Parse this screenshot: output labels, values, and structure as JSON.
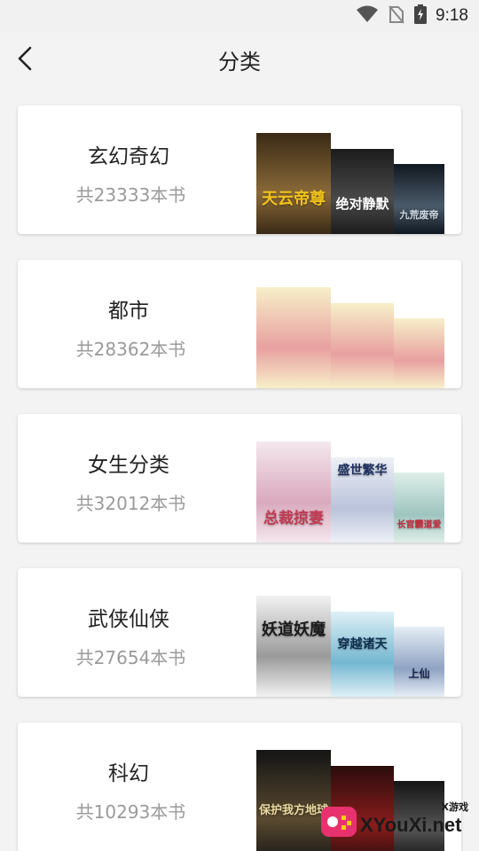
{
  "status_bar": {
    "time": "9:18",
    "icons": [
      "wifi-icon",
      "no-sim-icon",
      "battery-charging-icon"
    ]
  },
  "header": {
    "title": "分类",
    "back_icon": "chevron-left-icon"
  },
  "categories": [
    {
      "name": "玄幻奇幻",
      "count": "共23333本书",
      "covers": [
        {
          "title": "天云帝尊",
          "palette": [
            "#3a2a16",
            "#8a6a38",
            "#f1c31a"
          ]
        },
        {
          "title": "绝对静默",
          "palette": [
            "#1c1c1c",
            "#4a4a4a",
            "#ffffff"
          ]
        },
        {
          "title": "九荒废帝",
          "palette": [
            "#101820",
            "#4a5a6a",
            "#cfd8e0"
          ]
        }
      ]
    },
    {
      "name": "都市",
      "count": "共28362本书",
      "covers": [
        {
          "title": "",
          "palette": [
            "#f7efc9",
            "#e8a0a0",
            "#7bb06a"
          ]
        },
        {
          "title": "",
          "palette": [
            "#f7efc9",
            "#e8a0a0",
            "#7bb06a"
          ]
        },
        {
          "title": "",
          "palette": [
            "#f7efc9",
            "#e8a0a0",
            "#7bb06a"
          ]
        }
      ]
    },
    {
      "name": "女生分类",
      "count": "共32012本书",
      "covers": [
        {
          "title": "总裁掠妻",
          "palette": [
            "#f4e8ee",
            "#d9a9bd",
            "#c23a52"
          ]
        },
        {
          "title": "盛世繁华",
          "palette": [
            "#eef0f6",
            "#b9c3db",
            "#1e3160"
          ]
        },
        {
          "title": "长官霸道爱",
          "palette": [
            "#dfeee8",
            "#9fc5c0",
            "#c22b3c"
          ]
        }
      ]
    },
    {
      "name": "武侠仙侠",
      "count": "共27654本书",
      "covers": [
        {
          "title": "妖道妖魔",
          "palette": [
            "#f2f2f2",
            "#9a9a9a",
            "#1a1a1a"
          ]
        },
        {
          "title": "穿越诸天",
          "palette": [
            "#dff0f6",
            "#74b7d1",
            "#0d3050"
          ]
        },
        {
          "title": "上仙",
          "palette": [
            "#e6eef6",
            "#8fa3c3",
            "#1a2550"
          ]
        }
      ]
    },
    {
      "name": "科幻",
      "count": "共10293本书",
      "covers": [
        {
          "title": "保护我方地球",
          "palette": [
            "#141414",
            "#5a4a30",
            "#e8d7a0"
          ]
        },
        {
          "title": "",
          "palette": [
            "#2a0c0c",
            "#8a1c1c",
            "#e0a0a0"
          ]
        },
        {
          "title": "",
          "palette": [
            "#151515",
            "#555555",
            "#cccccc"
          ]
        }
      ]
    }
  ],
  "watermark": {
    "text": "XYouXi.net",
    "small": "X游戏"
  }
}
